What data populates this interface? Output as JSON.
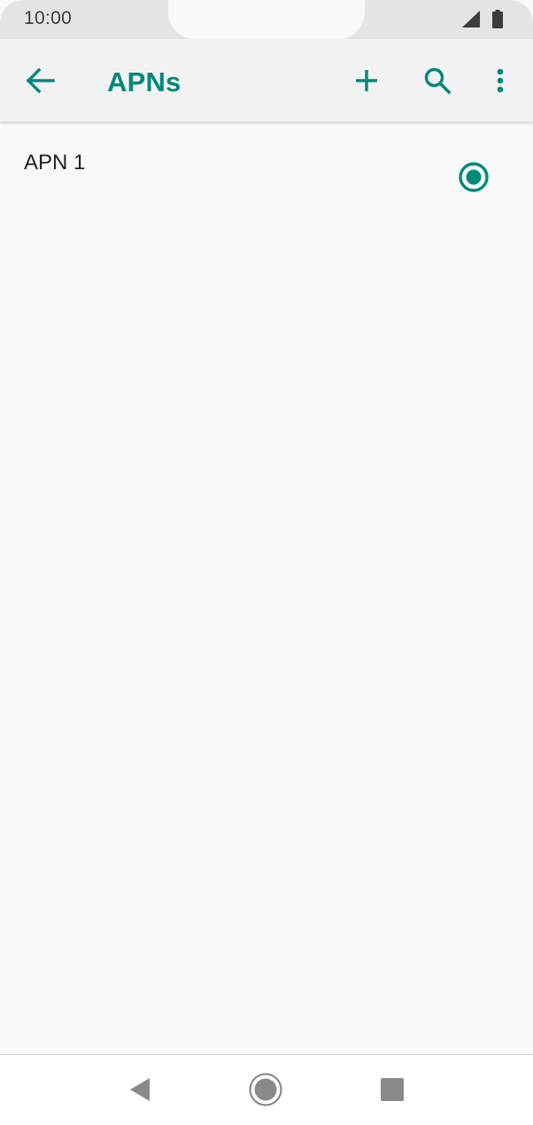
{
  "status_bar": {
    "time": "10:00",
    "signal_icon": "signal-icon",
    "battery_icon": "battery-icon"
  },
  "app_bar": {
    "title": "APNs",
    "back_icon": "arrow-back-icon",
    "add_icon": "add-icon",
    "search_icon": "search-icon",
    "more_icon": "more-vert-icon"
  },
  "apn_list": {
    "items": [
      {
        "label": "APN 1",
        "selected": true
      }
    ]
  },
  "nav_bar": {
    "back_icon": "nav-back-icon",
    "home_icon": "nav-home-icon",
    "recents_icon": "nav-recents-icon"
  },
  "colors": {
    "accent": "#00897b",
    "background": "#f9f9f9",
    "status_bar": "#e4e4e4",
    "app_bar": "#f2f2f2",
    "text": "#222222",
    "nav_icon": "#8a8a8a"
  }
}
